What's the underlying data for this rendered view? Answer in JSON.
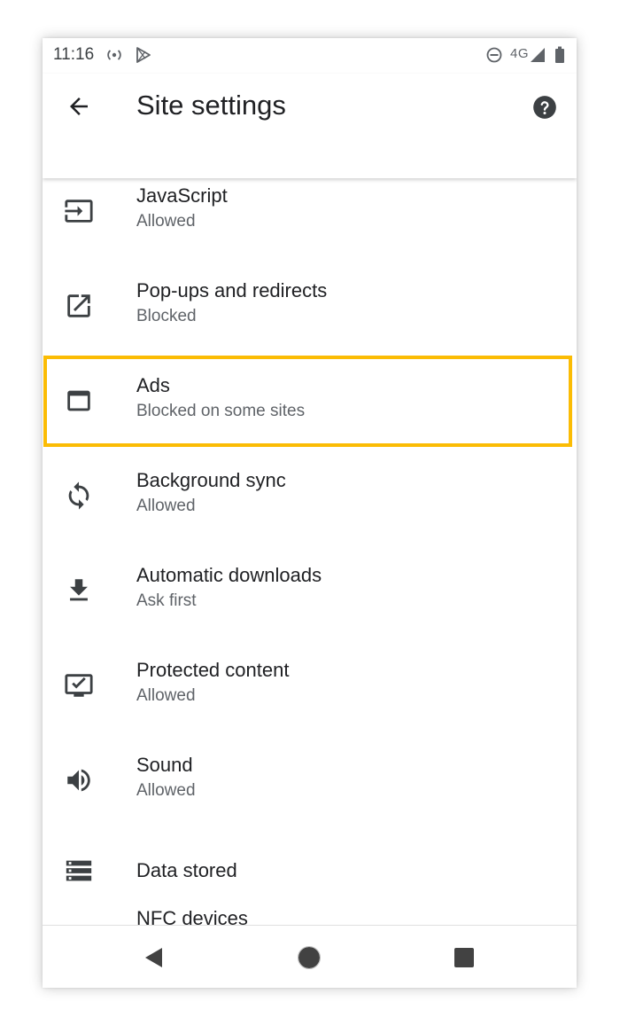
{
  "status_bar": {
    "time": "11:16",
    "network": "4G",
    "icons": [
      "hotspot-icon",
      "play-store-icon",
      "do-not-disturb-icon",
      "signal-icon",
      "battery-icon"
    ]
  },
  "app_bar": {
    "title": "Site settings",
    "back_icon": "arrow-back-icon",
    "help_icon": "help-icon"
  },
  "settings": [
    {
      "title": "JavaScript",
      "subtitle": "Allowed",
      "icon": "javascript-icon"
    },
    {
      "title": "Pop-ups and redirects",
      "subtitle": "Blocked",
      "icon": "open-in-new-icon",
      "highlighted": true
    },
    {
      "title": "Ads",
      "subtitle": "Blocked on some sites",
      "icon": "ads-icon"
    },
    {
      "title": "Background sync",
      "subtitle": "Allowed",
      "icon": "sync-icon"
    },
    {
      "title": "Automatic downloads",
      "subtitle": "Ask first",
      "icon": "download-icon"
    },
    {
      "title": "Protected content",
      "subtitle": "Allowed",
      "icon": "protected-content-icon"
    },
    {
      "title": "Sound",
      "subtitle": "Allowed",
      "icon": "volume-icon"
    },
    {
      "title": "Data stored",
      "subtitle": "",
      "icon": "storage-icon"
    },
    {
      "title": "NFC devices",
      "subtitle": "",
      "icon": "nfc-icon"
    }
  ],
  "nav_bar": {
    "buttons": [
      "back-triangle-icon",
      "home-circle-icon",
      "recents-square-icon"
    ]
  },
  "colors": {
    "highlight": "#fbbc04",
    "text_primary": "#202124",
    "text_secondary": "#5f6368",
    "icon": "#3c4043"
  }
}
